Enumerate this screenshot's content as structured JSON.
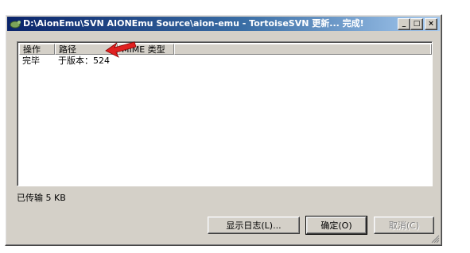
{
  "window": {
    "title": "D:\\AionEmu\\SVN AIONEmu Source\\aion-emu - TortoiseSVN 更新... 完成!",
    "min_glyph": "_",
    "max_glyph": "□",
    "close_glyph": "×"
  },
  "list": {
    "columns": [
      "操作",
      "路径",
      "MIME 类型"
    ],
    "rows": [
      {
        "action": "完毕",
        "path": "于版本：524"
      }
    ]
  },
  "status": {
    "transferred": "已传输 5 KB"
  },
  "buttons": {
    "show_log": "显示日志(L)...",
    "ok": "确定(O)",
    "cancel": "取消(C)"
  },
  "colors": {
    "annotation_arrow": "#e02020"
  }
}
